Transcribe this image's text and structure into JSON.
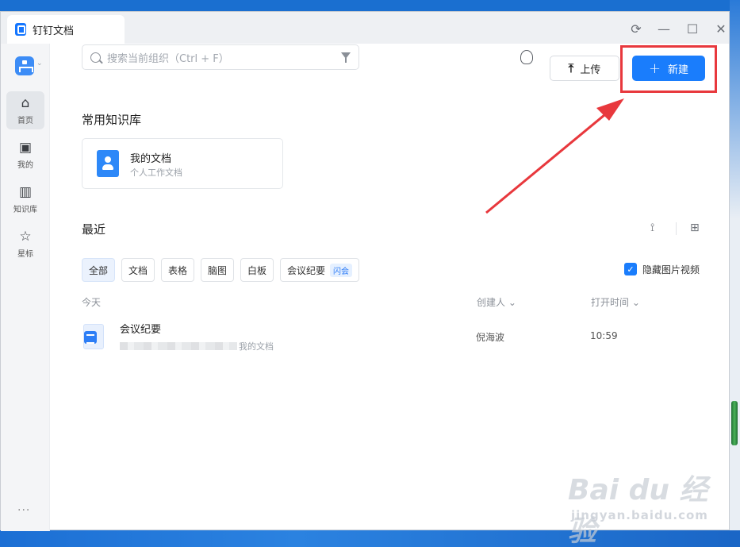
{
  "window": {
    "tab_title": "钉钉文档",
    "controls": {
      "sync_icon": "⟳",
      "minimize_icon": "—",
      "maximize_icon": "☐",
      "close_icon": "✕"
    }
  },
  "sidebar": {
    "items": [
      {
        "label": "首页",
        "icon": "⌂",
        "icon_name": "home-icon"
      },
      {
        "label": "我的",
        "icon": "▣",
        "icon_name": "my-doc-icon"
      },
      {
        "label": "知识库",
        "icon": "▥",
        "icon_name": "book-icon"
      },
      {
        "label": "星标",
        "icon": "☆",
        "icon_name": "star-icon"
      }
    ],
    "more": "···"
  },
  "search": {
    "placeholder": "搜索当前组织（Ctrl + F）"
  },
  "toolbar": {
    "upload_icon": "⤒",
    "upload_label": "上传",
    "new_icon": "+",
    "new_label": "新建",
    "accent": "#1a7dfc"
  },
  "knowledge": {
    "section_title": "常用知识库",
    "card_name": "我的文档",
    "card_desc": "个人工作文档"
  },
  "recent": {
    "section_title": "最近",
    "filters": [
      {
        "label": "全部",
        "active": true
      },
      {
        "label": "文档"
      },
      {
        "label": "表格"
      },
      {
        "label": "脑图"
      },
      {
        "label": "白板"
      },
      {
        "label": "会议纪要",
        "badge": "闪会"
      }
    ],
    "hide_media_label": "隐藏图片视频",
    "hide_media_checked": true,
    "group_label": "今天",
    "col_creator": "创建人",
    "col_opened": "打开时间",
    "rows": [
      {
        "title": "会议纪要",
        "path_suffix": "我的文档",
        "creator": "倪海波",
        "time": "10:59"
      }
    ]
  },
  "watermark": {
    "text": "Bai du 经验",
    "url": "jingyan.baidu.com"
  }
}
